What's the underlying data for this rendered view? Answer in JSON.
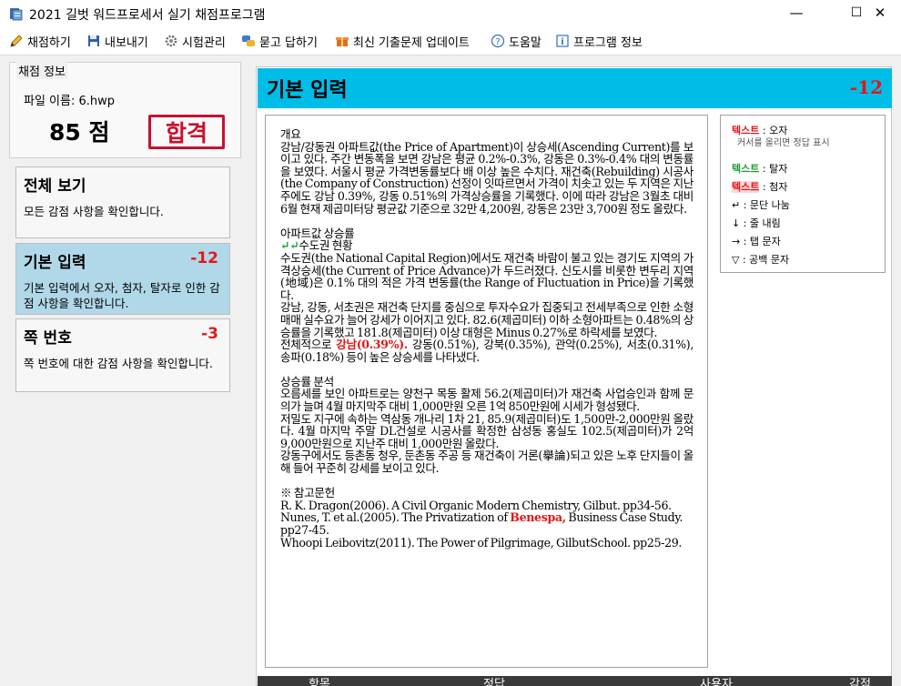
{
  "window": {
    "title": "2021 길벗 워드프로세서 실기 채점프로그램",
    "minimize": "—",
    "maximize": "☐",
    "close": "✕"
  },
  "toolbar": {
    "items": [
      {
        "label": "채점하기",
        "icon": "pencil-icon"
      },
      {
        "label": "내보내기",
        "icon": "floppy-disk-icon"
      },
      {
        "label": "시험관리",
        "icon": "gear-icon"
      },
      {
        "label": "묻고 답하기",
        "icon": "chat-icon"
      },
      {
        "label": "최신 기출문제 업데이트",
        "icon": "gift-icon"
      },
      {
        "label": "도움말",
        "icon": "help-icon"
      },
      {
        "label": "프로그램 정보",
        "icon": "info-icon"
      }
    ]
  },
  "score_info": {
    "group_title": "채점 정보",
    "filename": "파일 이름: 6.hwp",
    "score": "85 점",
    "result": "합격",
    "result_color": "#c8102e"
  },
  "categories": [
    {
      "title": "전체 보기",
      "penalty": "",
      "desc": "모든 감점 사항을 확인합니다.",
      "active": false
    },
    {
      "title": "기본 입력",
      "penalty": "-12",
      "desc": "기본 입력에서 오자, 첨자, 탈자로 인한 감점 사항을 확인합니다.",
      "active": true
    },
    {
      "title": "쪽 번호",
      "penalty": "-3",
      "desc": "쪽 번호에 대한 감점 사항을 확인합니다.",
      "active": false
    }
  ],
  "section": {
    "title": "기본 입력",
    "penalty": "-12",
    "header_color": "#00bde8"
  },
  "document": {
    "p1_title": "개요",
    "p1": "강남/강동권 아파트값(the Price of Apartment)이 상승세(Ascending Current)를 보이고 있다. 주간 변동폭을 보면 강남은 평균 0.2%-0.3%, 강동은 0.3%-0.4% 대의 변동률을 보였다. 서울시 평균 가격변동률보다 배 이상 높은 수치다. 재건축(Rebuilding) 시공사(the Company of Construction) 선정이 잇따르면서 가격이 치솟고 있는 두 지역은 지난주에도 강남 0.39%, 강동 0.51%의 가격상승률을 기록했다. 이에 따라 강남은 3월초 대비 6월 현재 제곱미터당 평균값 기준으로 32만 4,200원, 강동은 23만 3,700원 정도 올랐다.",
    "p2_title": "아파트값 상승률",
    "p2_sub_mark": "↵↵",
    "p2_sub": "수도권 현황",
    "p2a": "수도권(the National Capital Region)에서도 재건축 바람이 불고 있는 경기도 지역의 가격상승세(the Current of Price Advance)가 두드러졌다. 신도시를 비롯한 변두리 지역(地域)은 0.1% 대의 적은 가격 변동률(the Range of Fluctuation in Price)을 기록했다.",
    "p2b": "강남, 강동, 서초권은 재건축 단지를 중심으로 투자수요가 집중되고 전세부족으로 인한 소형 매매 실수요가 늘어 강세가 이어지고 있다. 82.6(제곱미터) 이하 소형아파트는 0.48%의 상승률을 기록했고 181.8(제곱미터) 이상 대형은 Minus 0.27%로 하락세를 보였다.",
    "p2c_pre": "전체적으로 ",
    "p2c_err": "강남(0.39%).",
    "p2c_post": " 강동(0.51%), 강북(0.35%), 관악(0.25%), 서초(0.31%), 송파(0.18%) 등이 높은 상승세를 나타냈다.",
    "p3_title": "상승률 분석",
    "p3a": "오름세를 보인 아파트로는 양천구 목동 활제 56.2(제곱미터)가 재건축 사업승인과 함께 문의가 늘며 4월 마지막주 대비 1,000만원 오른 1억 850만원에 시세가 형성됐다.",
    "p3b": "저밀도 지구에 속하는 역삼동 개나리 1차 21, 85.9(제곱미터)도 1,500만-2,000만원 올랐다. 4월 마지막 주말 DL건설로 시공사를 확정한 삼성동 홍실도 102.5(제곱미터)가 2억 9,000만원으로 지난주 대비 1,000만원 올랐다.",
    "p3c": "강동구에서도 등촌동 청우, 둔촌동 주공 등 재건축이 거론(擧論)되고 있은 노후 단지들이 올해 들어 꾸준히 강세를 보이고 있다.",
    "ref_title": "※ 참고문헌",
    "ref1": "R. K. Dragon(2006). A Civil Organic Modern Chemistry, Gilbut. pp34-56.",
    "ref2_pre": "Nunes, T. et al.(2005). The Privatization of ",
    "ref2_err": "Benespa,",
    "ref2_post": " Business Case Study. pp27-45.",
    "ref3": "Whoopi Leibovitz(2011). The Power of Pilgrimage, GilbutSchool. pp25-29."
  },
  "legend": {
    "typo_label": "텍스트",
    "typo_desc": " : 오자",
    "typo_hint": "커서를 올리면 정답 표시",
    "missing_label": "텍스트",
    "missing_desc": " : 탈자",
    "extra_label": "텍스트",
    "extra_desc": " : 첨자",
    "para_symbol": "↵",
    "para_desc": " : 문단 나눔",
    "line_symbol": "↓",
    "line_desc": " : 줄 내림",
    "tab_symbol": "→",
    "tab_desc": " : 탭 문자",
    "space_symbol": "▽",
    "space_desc": " : 공백 문자",
    "typo_color": "#e21818",
    "missing_color": "#1f9b3a"
  },
  "bottom_table": {
    "columns": [
      "항목",
      "정답",
      "사용자",
      "감점"
    ]
  }
}
